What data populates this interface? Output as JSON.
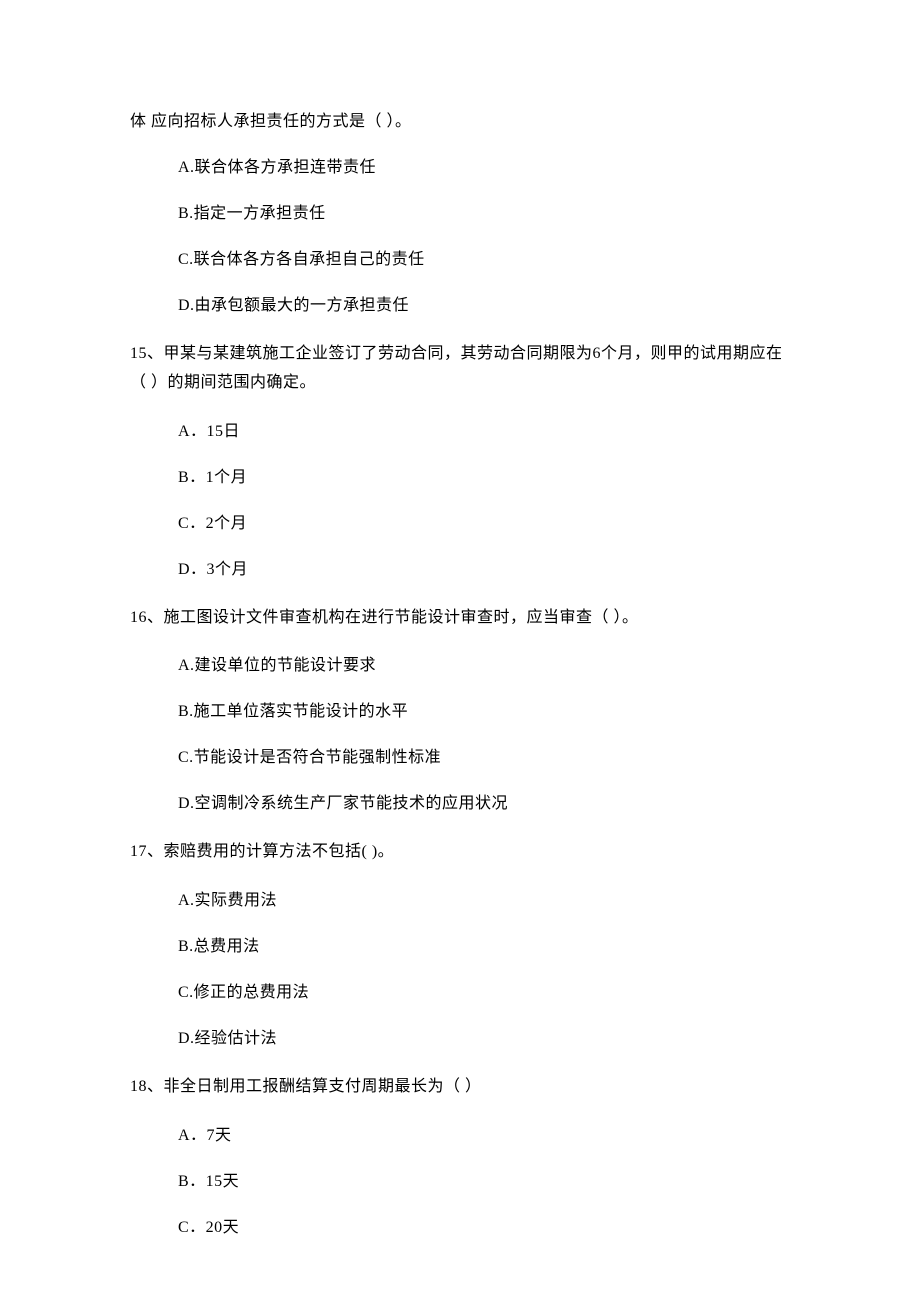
{
  "continuationLine": "体 应向招标人承担责任的方式是（    ）。",
  "q14Options": {
    "a": "A.联合体各方承担连带责任",
    "b": "B.指定一方承担责任",
    "c": "C.联合体各方各自承担自己的责任",
    "d": "D.由承包额最大的一方承担责任"
  },
  "q15": {
    "text": "15、甲某与某建筑施工企业签订了劳动合同，其劳动合同期限为6个月，则甲的试用期应在（    ）的期间范围内确定。",
    "options": {
      "a": "A．15日",
      "b": "B．1个月",
      "c": "C．2个月",
      "d": "D．3个月"
    }
  },
  "q16": {
    "text": "16、施工图设计文件审查机构在进行节能设计审查时，应当审查（     ）。",
    "options": {
      "a": "A.建设单位的节能设计要求",
      "b": "B.施工单位落实节能设计的水平",
      "c": "C.节能设计是否符合节能强制性标准",
      "d": "D.空调制冷系统生产厂家节能技术的应用状况"
    }
  },
  "q17": {
    "text": "17、索赔费用的计算方法不包括(      )。",
    "options": {
      "a": "A.实际费用法",
      "b": "B.总费用法",
      "c": "C.修正的总费用法",
      "d": "D.经验估计法"
    }
  },
  "q18": {
    "text": "18、非全日制用工报酬结算支付周期最长为（    ）",
    "options": {
      "a": "A．7天",
      "b": "B．15天",
      "c": "C．20天"
    }
  }
}
